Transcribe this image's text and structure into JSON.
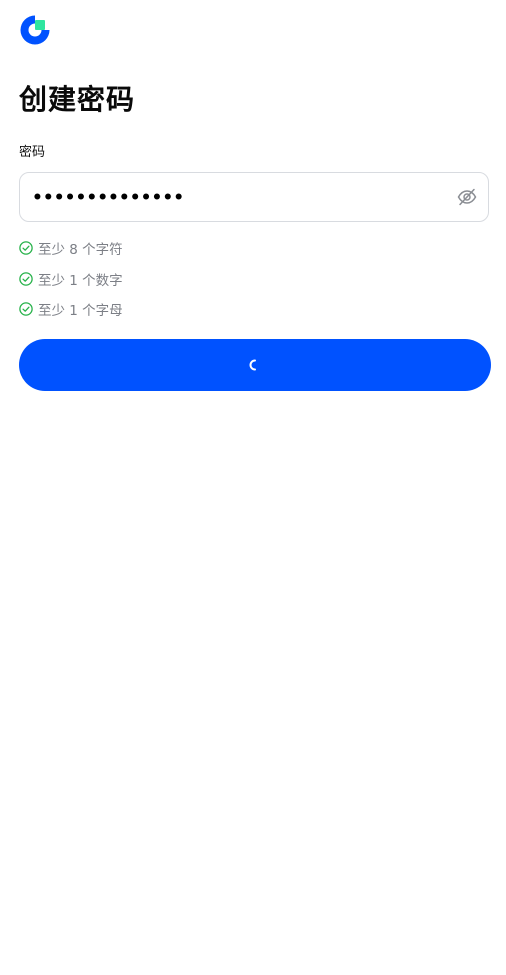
{
  "brand": {
    "logo_icon": "coinbase-wallet-logo-icon",
    "primary_color": "#0052ff",
    "accent_color": "#2ee6a0"
  },
  "page": {
    "title": "创建密码"
  },
  "password_field": {
    "label": "密码",
    "value": "••••••••••••••",
    "toggle_icon": "eye-off-icon"
  },
  "requirements": [
    {
      "text": "至少 8 个字符",
      "met": true,
      "icon": "check-circle-icon"
    },
    {
      "text": "至少 1 个数字",
      "met": true,
      "icon": "check-circle-icon"
    },
    {
      "text": "至少 1 个字母",
      "met": true,
      "icon": "check-circle-icon"
    }
  ],
  "submit_button": {
    "state": "loading",
    "icon": "spinner-icon",
    "color": "#0052ff"
  },
  "colors": {
    "check_green": "#27b24a",
    "requirement_text": "#7c7f86"
  }
}
